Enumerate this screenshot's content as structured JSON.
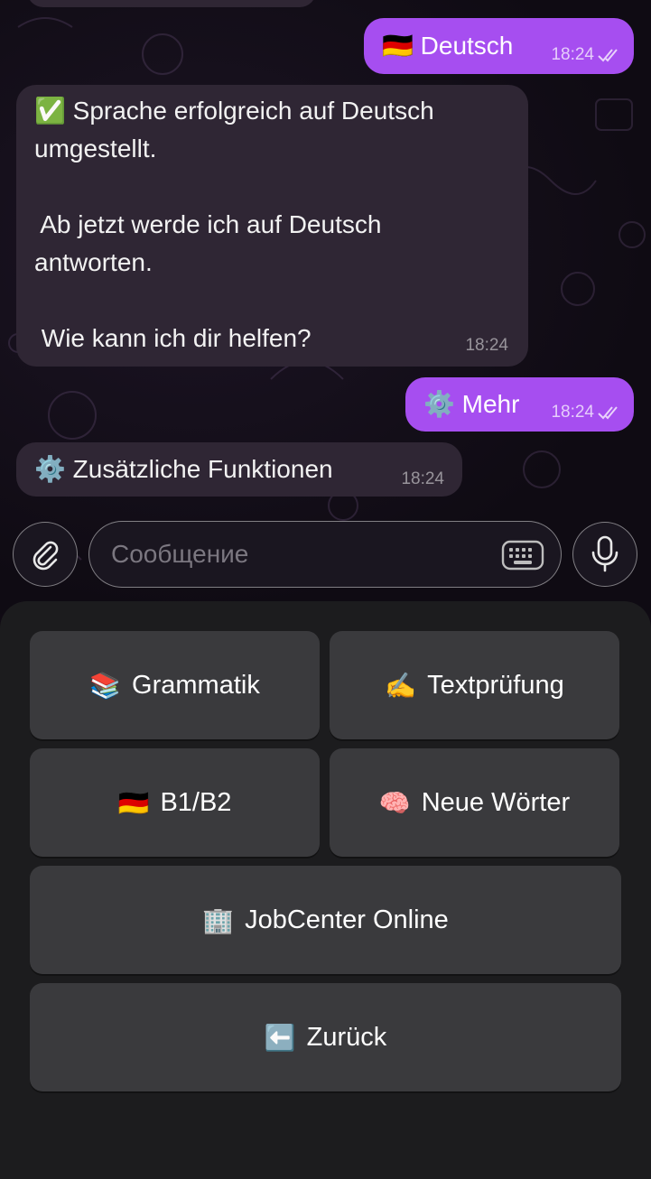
{
  "messages": [
    {
      "text": "Deutsch",
      "emoji": "🇩🇪",
      "time": "18:24"
    },
    {
      "lines": [
        "✅ Sprache erfolgreich auf Deutsch",
        "umgestellt.",
        "",
        " Ab jetzt werde ich auf Deutsch",
        "antworten.",
        "",
        " Wie kann ich dir helfen?"
      ],
      "time": "18:24"
    },
    {
      "text": "Mehr",
      "emoji": "⚙️",
      "time": "18:24"
    },
    {
      "text": "Zusätzliche Funktionen",
      "emoji": "⚙️",
      "time": "18:24"
    }
  ],
  "composer": {
    "placeholder": "Сообщение"
  },
  "keyboard": {
    "buttons": [
      {
        "emoji": "📚",
        "label": "Grammatik"
      },
      {
        "emoji": "✍️",
        "label": "Textprüfung"
      },
      {
        "emoji": "🇩🇪",
        "label": "B1/B2"
      },
      {
        "emoji": "🧠",
        "label": "Neue Wörter"
      },
      {
        "emoji": "🏢",
        "label": "JobCenter Online"
      },
      {
        "emoji": "⬅️",
        "label": "Zurück"
      }
    ]
  },
  "colors": {
    "outgoing_bubble": "#a64ef0",
    "incoming_bubble": "#2f2634",
    "keyboard_button": "#3a3a3d",
    "keyboard_panel": "#1c1c1e"
  }
}
